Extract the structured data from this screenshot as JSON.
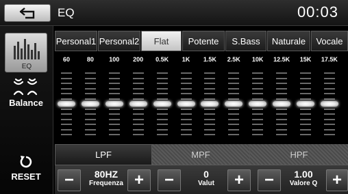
{
  "header": {
    "title": "EQ",
    "clock": "00:03",
    "back_icon": "back-arrow-icon"
  },
  "sidebar": {
    "eq_label": "EQ",
    "balance_label": "Balance",
    "reset_label": "RESET"
  },
  "presets": [
    {
      "label": "Personal1",
      "active": false
    },
    {
      "label": "Personal2",
      "active": false
    },
    {
      "label": "Flat",
      "active": true
    },
    {
      "label": "Potente",
      "active": false
    },
    {
      "label": "S.Bass",
      "active": false
    },
    {
      "label": "Naturale",
      "active": false
    },
    {
      "label": "Vocale",
      "active": false
    }
  ],
  "bands": [
    {
      "freq": "60",
      "level": 0
    },
    {
      "freq": "80",
      "level": 0
    },
    {
      "freq": "100",
      "level": 0
    },
    {
      "freq": "200",
      "level": 0
    },
    {
      "freq": "0.5K",
      "level": 0
    },
    {
      "freq": "1K",
      "level": 0
    },
    {
      "freq": "1.5K",
      "level": 0
    },
    {
      "freq": "2.5K",
      "level": 0
    },
    {
      "freq": "10K",
      "level": 0
    },
    {
      "freq": "12.5K",
      "level": 0
    },
    {
      "freq": "15K",
      "level": 0
    },
    {
      "freq": "17.5K",
      "level": 0
    }
  ],
  "filter_tabs": [
    {
      "label": "LPF",
      "active": true
    },
    {
      "label": "MPF",
      "active": false
    },
    {
      "label": "HPF",
      "active": false
    }
  ],
  "controls": {
    "frequency": {
      "value": "80HZ",
      "label": "Frequenza"
    },
    "gain": {
      "value": "0",
      "label": "Valut"
    },
    "q": {
      "value": "1.00",
      "label": "Valore Q"
    },
    "minus": "−",
    "plus": "+"
  }
}
